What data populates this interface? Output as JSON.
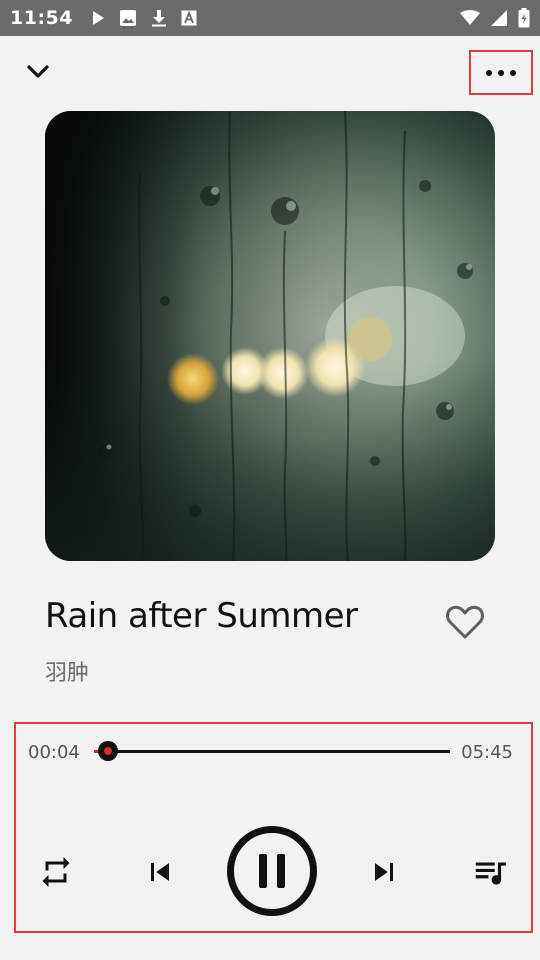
{
  "status_bar": {
    "time": "11:54",
    "left_icons": [
      "play-icon",
      "image-icon",
      "download-icon",
      "font-icon"
    ],
    "right_icons": [
      "wifi-icon",
      "signal-icon",
      "battery-icon"
    ]
  },
  "header": {
    "collapse_icon": "chevron-down-icon",
    "more_icon": "more-horizontal-icon"
  },
  "song": {
    "title": "Rain after Summer",
    "artist": "羽肿",
    "liked": false
  },
  "player": {
    "current_time": "00:04",
    "total_time": "05:45",
    "progress_fraction": 0.04,
    "state": "playing"
  },
  "controls": [
    "repeat-icon",
    "skip-previous-icon",
    "pause-icon",
    "skip-next-icon",
    "queue-music-icon"
  ],
  "colors": {
    "accent": "#d62a2a",
    "highlight_border": "#e03c3c",
    "status_bar": "#6b6b6b",
    "background": "#f2f2f2"
  }
}
